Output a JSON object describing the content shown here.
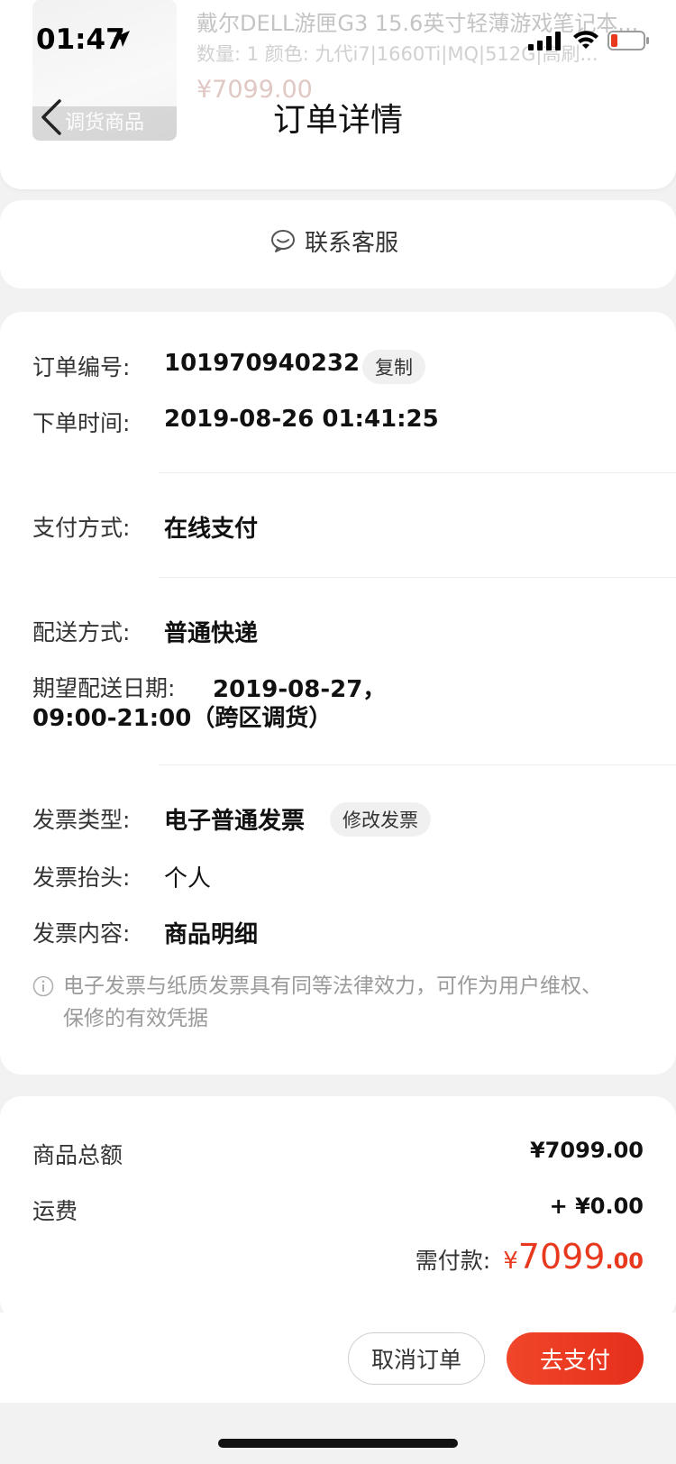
{
  "status_bar": {
    "time": "01:47"
  },
  "background_product": {
    "title": "戴尔DELL游匣G3 15.6英寸轻薄游戏笔记本...",
    "spec": "数量: 1  颜色: 九代i7|1660Ti|MQ|512G|高刷...",
    "price": "¥7099.00",
    "badge": "调货商品"
  },
  "nav": {
    "title": "订单详情"
  },
  "contact": {
    "label": "联系客服"
  },
  "order_info": {
    "order_no_label": "订单编号:",
    "order_no": "101970940232",
    "copy_label": "复制",
    "time_label": "下单时间:",
    "time_value": "2019-08-26 01:41:25",
    "payment_label": "支付方式:",
    "payment_value": "在线支付",
    "delivery_label": "配送方式:",
    "delivery_value": "普通快递",
    "expected_label": "期望配送日期:",
    "expected_value_line1": "2019-08-27，",
    "expected_value_line2": "09:00-21:00（跨区调货）",
    "invoice_type_label": "发票类型:",
    "invoice_type_value": "电子普通发票",
    "modify_invoice_label": "修改发票",
    "invoice_header_label": "发票抬头:",
    "invoice_header_value": "个人",
    "invoice_content_label": "发票内容:",
    "invoice_content_value": "商品明细",
    "note_line1": "电子发票与纸质发票具有同等法律效力，可作为用户维权、",
    "note_line2": "保修的有效凭据"
  },
  "amounts": {
    "goods_total_label": "商品总额",
    "goods_total_value": "¥7099.00",
    "shipping_label": "运费",
    "shipping_value": "+ ¥0.00",
    "pay_label": "需付款:",
    "pay_currency": "¥",
    "pay_int": "7099",
    "pay_dec": ".00"
  },
  "actions": {
    "cancel_label": "取消订单",
    "pay_label": "去支付"
  },
  "colors": {
    "accent": "#e8391f",
    "background": "#f2f2f2"
  }
}
